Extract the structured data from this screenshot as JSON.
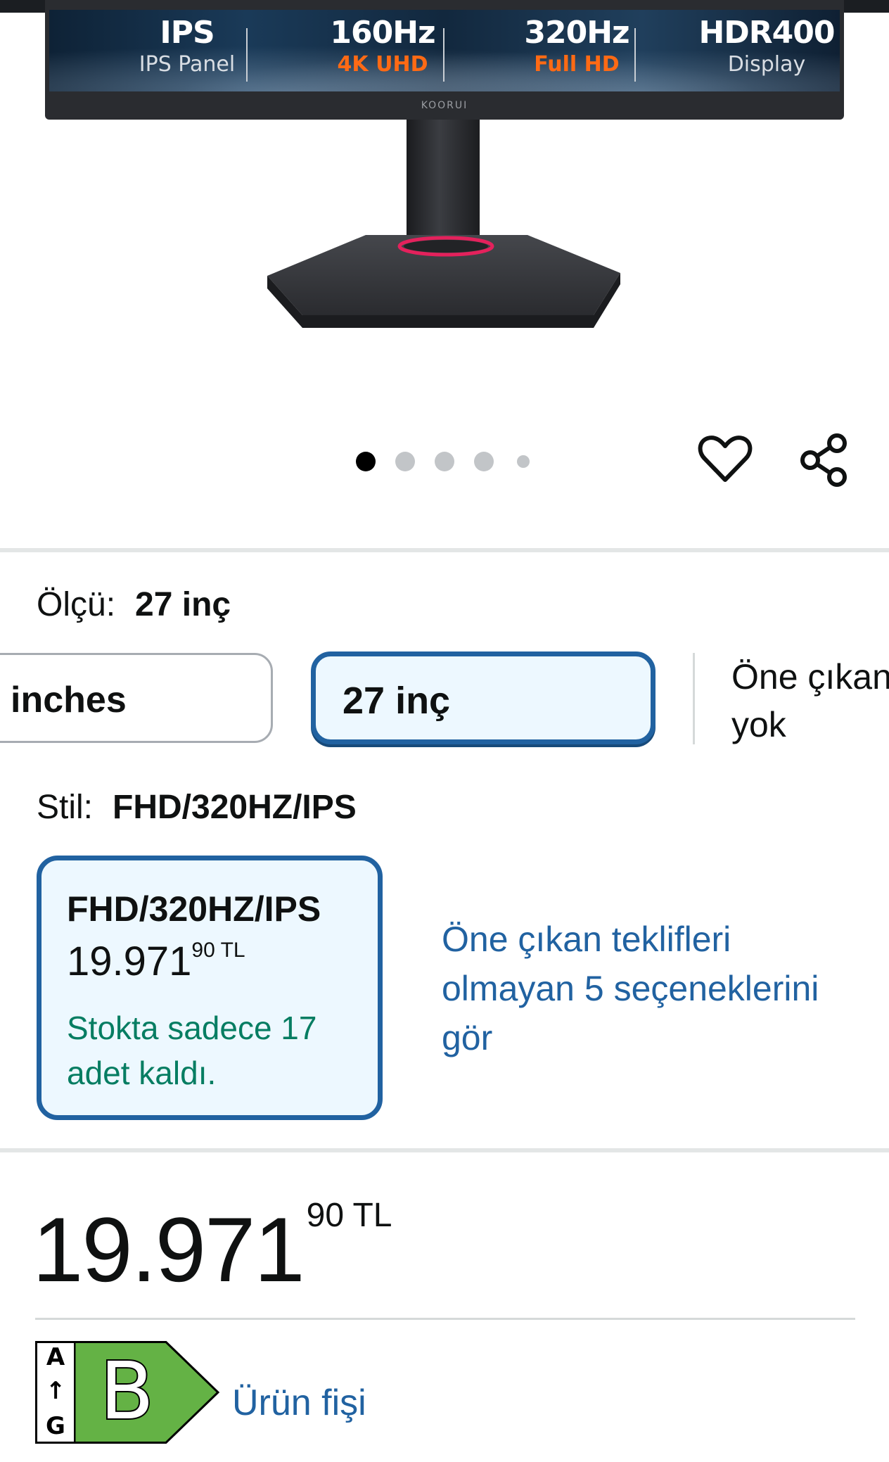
{
  "hero": {
    "brand": "KOORUI",
    "specs": [
      {
        "big": "IPS",
        "small": "IPS Panel",
        "color": "white"
      },
      {
        "big": "160Hz",
        "small": "4K UHD",
        "color": "orange"
      },
      {
        "big": "320Hz",
        "small": "Full HD",
        "color": "orange"
      },
      {
        "big": "HDR400",
        "small": "Display",
        "color": "white"
      }
    ],
    "image_count": 5,
    "active_image": 1
  },
  "actions": {
    "favorite_icon": "heart-icon",
    "share_icon": "share-icon"
  },
  "size": {
    "label": "Ölçü:",
    "selected": "27 inç",
    "options": [
      {
        "label": "inches",
        "selected": false
      },
      {
        "label": "27 inç",
        "selected": true
      }
    ],
    "more_line1": "Öne çıkan",
    "more_line2": "yok"
  },
  "style": {
    "label": "Stil:",
    "selected": "FHD/320HZ/IPS",
    "card": {
      "name": "FHD/320HZ/IPS",
      "price_whole": "19.971",
      "price_fraction": "90",
      "currency": "TL",
      "stock": "Stokta sadece 17 adet kaldı."
    },
    "see_options": "Öne çıkan teklifleri olmayan 5 seçeneklerini gör"
  },
  "price": {
    "whole": "19.971",
    "fraction": "90",
    "currency": "TL"
  },
  "energy": {
    "scale_top": "A",
    "scale_arrow": "↑",
    "scale_bottom": "G",
    "grade": "B",
    "grade_color": "#64b245",
    "product_sheet": "Ürün fişi"
  },
  "colors": {
    "link": "#2162a1",
    "selected_border": "#2162a1",
    "selected_bg": "#edf8ff",
    "stock_green": "#067d62",
    "accent_orange": "#ff6a14",
    "stand_ring": "#e4215c"
  }
}
